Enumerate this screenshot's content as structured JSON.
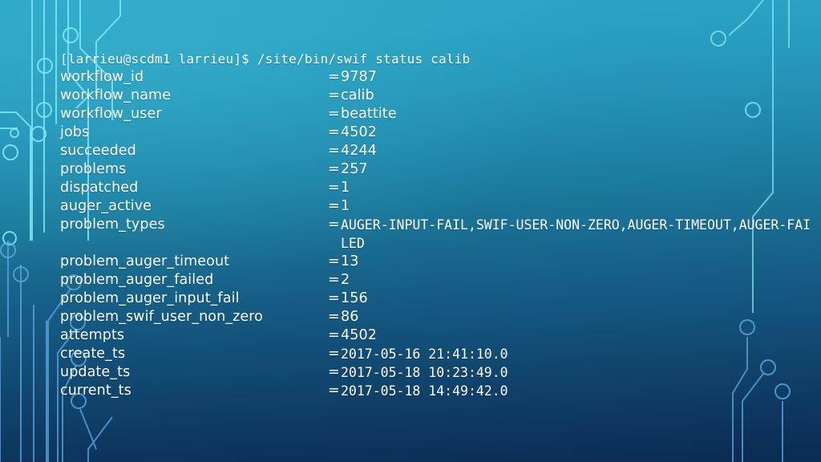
{
  "theme": {
    "gradient_top": "#2ba5c6",
    "gradient_bottom": "#0b2b52",
    "text_color": "#ffffff",
    "circuit_color_light": "#6fe3f5",
    "circuit_color_dark": "#4d8fd6"
  },
  "terminal": {
    "prompt_line": "[larrieu@scdm1 larrieu]$ /site/bin/swif status calib",
    "prompt_user": "larrieu",
    "prompt_host": "scdm1",
    "prompt_cwd": "larrieu",
    "prompt_symbol": "$",
    "command": "/site/bin/swif status calib",
    "separator": "=",
    "rows": [
      {
        "key": "workflow_id",
        "value": "9787"
      },
      {
        "key": "workflow_name",
        "value": "calib"
      },
      {
        "key": "workflow_user",
        "value": "beattite"
      },
      {
        "key": "jobs",
        "value": "4502"
      },
      {
        "key": "succeeded",
        "value": "4244"
      },
      {
        "key": "problems",
        "value": "257"
      },
      {
        "key": "dispatched",
        "value": "1"
      },
      {
        "key": "auger_active",
        "value": "1"
      },
      {
        "key": "problem_types",
        "value": "AUGER-INPUT-FAIL,SWIF-USER-NON-ZERO,AUGER-TIMEOUT,AUGER-FAILED"
      },
      {
        "key": "problem_auger_timeout",
        "value": "13"
      },
      {
        "key": "problem_auger_failed",
        "value": "2"
      },
      {
        "key": "problem_auger_input_fail",
        "value": "156"
      },
      {
        "key": "problem_swif_user_non_zero",
        "value": "86"
      },
      {
        "key": "attempts",
        "value": "4502"
      },
      {
        "key": "create_ts",
        "value": "2017-05-16 21:41:10.0"
      },
      {
        "key": "update_ts",
        "value": "2017-05-18 10:23:49.0"
      },
      {
        "key": "current_ts",
        "value": "2017-05-18 14:49:42.0"
      }
    ]
  },
  "decoration": {
    "left_icon": "circuit-board-trace-pattern",
    "right_icon": "circuit-board-trace-pattern"
  }
}
